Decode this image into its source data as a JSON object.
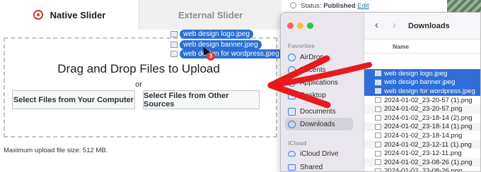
{
  "uploader": {
    "tabs": [
      {
        "label": "Native Slider",
        "active": true
      },
      {
        "label": "External Slider",
        "active": false
      }
    ],
    "drop_title": "Drag and Drop Files to Upload",
    "or_text": "or",
    "btn_computer": "Select Files from Your Computer",
    "btn_other": "Select Files from Other Sources",
    "max_size": "Maximum upload file size: 512 MB.",
    "dragged_files": [
      "web design logo.jpeg",
      "web design banner.jpeg",
      "web design for wordpress.jpeg"
    ],
    "drag_count": "3"
  },
  "wp": {
    "status_label": "Status:",
    "status_value": "Published",
    "edit_link": "Edit"
  },
  "finder": {
    "favorites_label": "Favorites",
    "icloud_label": "iCloud",
    "sidebar_favorites": [
      {
        "label": "AirDrop",
        "icon": "airdrop-icon",
        "selected": false
      },
      {
        "label": "Recents",
        "icon": "clock-icon",
        "selected": false
      },
      {
        "label": "Applications",
        "icon": "applications-icon",
        "selected": false
      },
      {
        "label": "Desktop",
        "icon": "desktop-icon",
        "selected": false
      },
      {
        "label": "Documents",
        "icon": "document-icon",
        "selected": false
      },
      {
        "label": "Downloads",
        "icon": "download-icon",
        "selected": true
      }
    ],
    "sidebar_icloud": [
      {
        "label": "iCloud Drive",
        "icon": "cloud-icon"
      },
      {
        "label": "Shared",
        "icon": "shared-folder-icon"
      }
    ],
    "folder_title": "Downloads",
    "column_name": "Name",
    "files": [
      {
        "name": "web design logo.jpeg",
        "selected": true
      },
      {
        "name": "web design banner.jpeg",
        "selected": true
      },
      {
        "name": "web design for wordpress.jpeg",
        "selected": true
      },
      {
        "name": "2024-01-02_23-20-57 (1).png",
        "selected": false
      },
      {
        "name": "2024-01-02_23-20-57.png",
        "selected": false
      },
      {
        "name": "2024-01-02_23-18-14 (2).png",
        "selected": false
      },
      {
        "name": "2024-01-02_23-18-14 (1).png",
        "selected": false
      },
      {
        "name": "2024-01-02_23-18-14.png",
        "selected": false
      },
      {
        "name": "2024-01-02_23-12-11 (1).png",
        "selected": false
      },
      {
        "name": "2024-01-02_23-12-11.png",
        "selected": false
      },
      {
        "name": "2024-01-02_23-08-26 (1).png",
        "selected": false
      },
      {
        "name": "2024-01-02_23-08-26.png",
        "selected": false
      }
    ]
  },
  "colors": {
    "accent_red": "#d63638",
    "selection_blue": "#2f6ed8",
    "annotation_red": "#e8191c",
    "link_blue": "#2271b1"
  }
}
